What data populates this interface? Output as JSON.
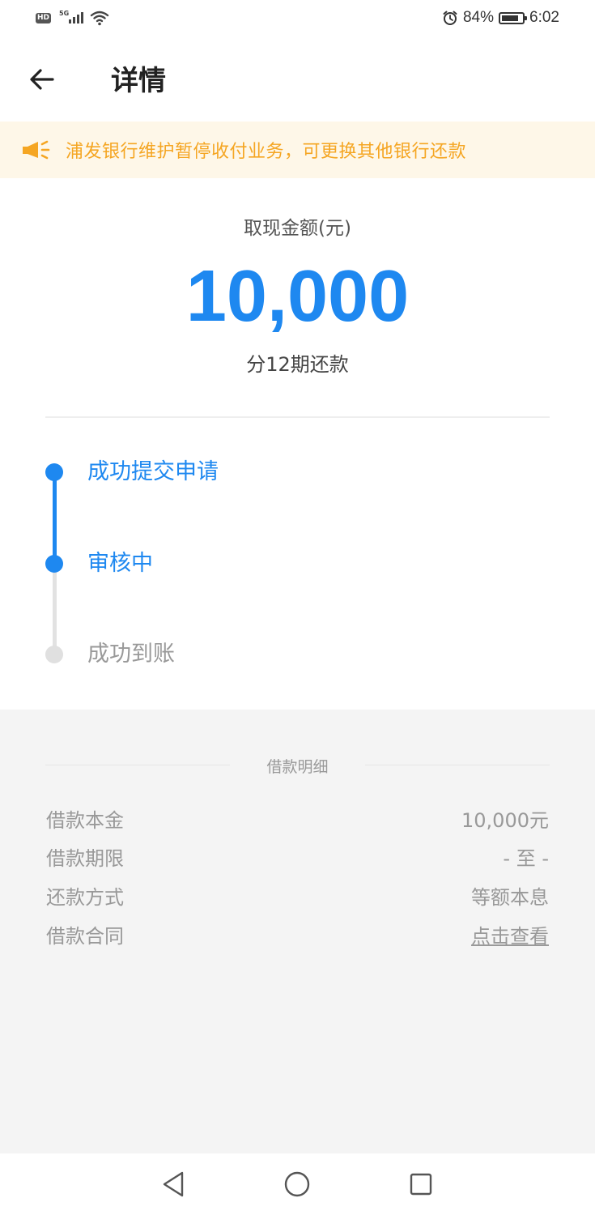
{
  "status_bar": {
    "network_badge": "HD",
    "network_type": "5G",
    "battery_percent": "84%",
    "battery_level": 0.84,
    "time": "6:02",
    "icons": [
      "hd-icon",
      "signal-icon",
      "wifi-icon",
      "alarm-icon",
      "battery-icon"
    ]
  },
  "header": {
    "title": "详情",
    "back_icon": "arrow-left-icon"
  },
  "notice": {
    "icon": "megaphone-icon",
    "text": "浦发银行维护暂停收付业务，可更换其他银行还款",
    "color": "#f5a623",
    "background": "#fef7e8"
  },
  "amount": {
    "label": "取现金额(元)",
    "value": "10,000",
    "installments": "分12期还款",
    "accent_color": "#1e88f0"
  },
  "timeline": {
    "steps": [
      {
        "label": "成功提交申请",
        "state": "done"
      },
      {
        "label": "审核中",
        "state": "current"
      },
      {
        "label": "成功到账",
        "state": "pending"
      }
    ]
  },
  "details": {
    "title": "借款明细",
    "rows": [
      {
        "label": "借款本金",
        "value": "10,000元"
      },
      {
        "label": "借款期限",
        "value": "- 至 -"
      },
      {
        "label": "还款方式",
        "value": "等额本息"
      },
      {
        "label": "借款合同",
        "value": "点击查看"
      }
    ]
  },
  "nav_bar": {
    "buttons": [
      "back-triangle-icon",
      "home-circle-icon",
      "recents-square-icon"
    ]
  }
}
